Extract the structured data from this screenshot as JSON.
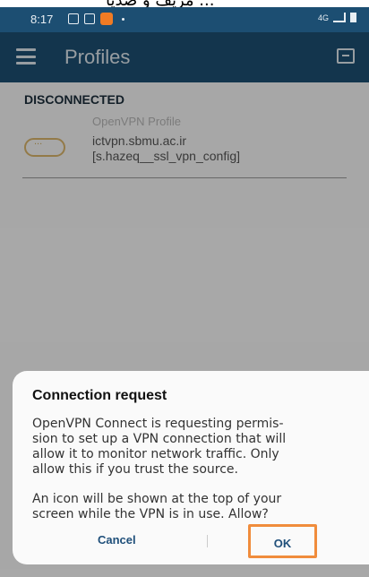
{
  "top_strip_text": "مریف و صدیا ...",
  "status_bar": {
    "time": "8:17",
    "network": "4G"
  },
  "app_bar": {
    "title": "Profiles",
    "menu_icon": "hamburger-menu-icon",
    "import_icon": "import-profile-icon",
    "background": "#1c4e72"
  },
  "profiles": {
    "section_header": "DISCONNECTED",
    "item": {
      "type": "OpenVPN Profile",
      "host": "ictvpn.sbmu.ac.ir",
      "user": "[s.hazeq__ssl_vpn_config]"
    }
  },
  "dialog": {
    "title": "Connection request",
    "body1": "OpenVPN Connect is requesting permis-\nsion to set up a VPN connection that will\nallow it to monitor network traffic. Only\nallow this if you trust the source.",
    "body2": "An icon will be shown at the top of your\nscreen while the VPN is in use. Allow?",
    "cancel_label": "Cancel",
    "ok_label": "OK",
    "highlight_color": "#f08c3c"
  }
}
